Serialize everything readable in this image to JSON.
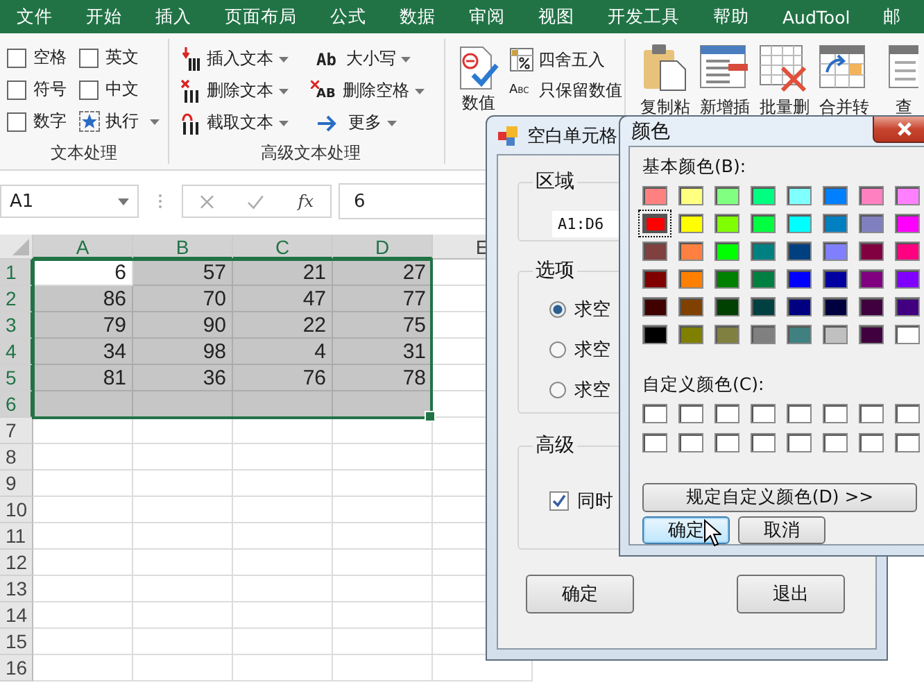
{
  "ribbon": {
    "tabs": [
      "文件",
      "开始",
      "插入",
      "页面布局",
      "公式",
      "数据",
      "审阅",
      "视图",
      "开发工具",
      "帮助",
      "AudTool",
      "邮"
    ],
    "text_group": {
      "title": "文本处理",
      "options": [
        {
          "label": "空格",
          "checked": false
        },
        {
          "label": "英文",
          "checked": false
        },
        {
          "label": "符号",
          "checked": false
        },
        {
          "label": "中文",
          "checked": false
        },
        {
          "label": "数字",
          "checked": false
        }
      ],
      "run_button": "执行"
    },
    "advanced_group": {
      "title": "高级文本处理",
      "buttons": [
        {
          "label": "插入文本",
          "kind": "insert"
        },
        {
          "label": "大小写",
          "kind": "case",
          "icon_text": "Ab"
        },
        {
          "label": "删除文本",
          "kind": "delete"
        },
        {
          "label": "删除空格",
          "kind": "trim",
          "icon_text": "AB"
        },
        {
          "label": "截取文本",
          "kind": "extract"
        },
        {
          "label": "更多",
          "kind": "more"
        }
      ]
    },
    "number_group": {
      "big_button": "数值",
      "buttons": [
        {
          "label": "四舍五入",
          "kind": "round"
        },
        {
          "label": "只保留数值",
          "kind": "numbers",
          "icon_text": "Abc"
        }
      ]
    },
    "tools": [
      {
        "label": "复制粘",
        "kind": "paste"
      },
      {
        "label": "新增插",
        "kind": "insert-row"
      },
      {
        "label": "批量删",
        "kind": "delete-table"
      },
      {
        "label": "合并转",
        "kind": "merge"
      },
      {
        "label": "查",
        "kind": "find"
      }
    ]
  },
  "formula_bar": {
    "name_box": "A1",
    "function_button": "fx",
    "value": "6"
  },
  "sheet": {
    "columns": [
      {
        "label": "A",
        "selected": true
      },
      {
        "label": "B",
        "selected": true
      },
      {
        "label": "C",
        "selected": true
      },
      {
        "label": "D",
        "selected": true
      },
      {
        "label": "E",
        "selected": false
      }
    ],
    "rows": [
      {
        "label": "1",
        "selected": true,
        "cells": [
          {
            "value": "6",
            "active": true
          },
          {
            "value": "57",
            "active": false
          },
          {
            "value": "21",
            "active": false
          },
          {
            "value": "27",
            "active": false
          }
        ]
      },
      {
        "label": "2",
        "selected": true,
        "cells": [
          {
            "value": "86",
            "active": false
          },
          {
            "value": "70",
            "active": false
          },
          {
            "value": "47",
            "active": false
          },
          {
            "value": "77",
            "active": false
          }
        ]
      },
      {
        "label": "3",
        "selected": true,
        "cells": [
          {
            "value": "79",
            "active": false
          },
          {
            "value": "90",
            "active": false
          },
          {
            "value": "22",
            "active": false
          },
          {
            "value": "75",
            "active": false
          }
        ]
      },
      {
        "label": "4",
        "selected": true,
        "cells": [
          {
            "value": "34",
            "active": false
          },
          {
            "value": "98",
            "active": false
          },
          {
            "value": "4",
            "active": false
          },
          {
            "value": "31",
            "active": false
          }
        ]
      },
      {
        "label": "5",
        "selected": true,
        "cells": [
          {
            "value": "81",
            "active": false
          },
          {
            "value": "36",
            "active": false
          },
          {
            "value": "76",
            "active": false
          },
          {
            "value": "78",
            "active": false
          }
        ]
      },
      {
        "label": "6",
        "selected": true
      },
      {
        "label": "7",
        "selected": false
      },
      {
        "label": "8",
        "selected": false
      },
      {
        "label": "9",
        "selected": false
      },
      {
        "label": "10",
        "selected": false
      },
      {
        "label": "11",
        "selected": false
      },
      {
        "label": "12",
        "selected": false
      },
      {
        "label": "13",
        "selected": false
      },
      {
        "label": "14",
        "selected": false
      },
      {
        "label": "15",
        "selected": false
      },
      {
        "label": "16",
        "selected": false
      }
    ]
  },
  "blank_dialog": {
    "title": "空白单元格",
    "range_label": "区域",
    "range": "A1:D6",
    "options_label": "选项",
    "options": [
      {
        "label": "求空",
        "selected": true
      },
      {
        "label": "求空",
        "selected": false
      },
      {
        "label": "求空",
        "selected": false
      }
    ],
    "advanced_label": "高级",
    "advanced_option": {
      "label": "同时",
      "checked": true
    },
    "buttons": [
      "确定",
      "退出"
    ]
  },
  "color_dialog": {
    "title": "颜色",
    "basic_label": "基本颜色(B):",
    "basic_colors": [
      {
        "color": "#ff8080",
        "selected": false
      },
      {
        "color": "#ffff80",
        "selected": false
      },
      {
        "color": "#80ff80",
        "selected": false
      },
      {
        "color": "#00ff80",
        "selected": false
      },
      {
        "color": "#80ffff",
        "selected": false
      },
      {
        "color": "#0080ff",
        "selected": false
      },
      {
        "color": "#ff80c0",
        "selected": false
      },
      {
        "color": "#ff80ff",
        "selected": false
      },
      {
        "color": "#ff0000",
        "selected": true
      },
      {
        "color": "#ffff00",
        "selected": false
      },
      {
        "color": "#80ff00",
        "selected": false
      },
      {
        "color": "#00ff40",
        "selected": false
      },
      {
        "color": "#00ffff",
        "selected": false
      },
      {
        "color": "#0080c0",
        "selected": false
      },
      {
        "color": "#8080c0",
        "selected": false
      },
      {
        "color": "#ff00ff",
        "selected": false
      },
      {
        "color": "#804040",
        "selected": false
      },
      {
        "color": "#ff8040",
        "selected": false
      },
      {
        "color": "#00ff00",
        "selected": false
      },
      {
        "color": "#008080",
        "selected": false
      },
      {
        "color": "#004080",
        "selected": false
      },
      {
        "color": "#8080ff",
        "selected": false
      },
      {
        "color": "#800040",
        "selected": false
      },
      {
        "color": "#ff0080",
        "selected": false
      },
      {
        "color": "#800000",
        "selected": false
      },
      {
        "color": "#ff8000",
        "selected": false
      },
      {
        "color": "#008000",
        "selected": false
      },
      {
        "color": "#008040",
        "selected": false
      },
      {
        "color": "#0000ff",
        "selected": false
      },
      {
        "color": "#0000a0",
        "selected": false
      },
      {
        "color": "#800080",
        "selected": false
      },
      {
        "color": "#8000ff",
        "selected": false
      },
      {
        "color": "#400000",
        "selected": false
      },
      {
        "color": "#804000",
        "selected": false
      },
      {
        "color": "#004000",
        "selected": false
      },
      {
        "color": "#004040",
        "selected": false
      },
      {
        "color": "#000080",
        "selected": false
      },
      {
        "color": "#000040",
        "selected": false
      },
      {
        "color": "#400040",
        "selected": false
      },
      {
        "color": "#400080",
        "selected": false
      },
      {
        "color": "#000000",
        "selected": false
      },
      {
        "color": "#808000",
        "selected": false
      },
      {
        "color": "#808040",
        "selected": false
      },
      {
        "color": "#808080",
        "selected": false
      },
      {
        "color": "#408080",
        "selected": false
      },
      {
        "color": "#c0c0c0",
        "selected": false
      },
      {
        "color": "#400040",
        "selected": false
      },
      {
        "color": "#ffffff",
        "selected": false
      }
    ],
    "custom_label": "自定义颜色(C):",
    "custom_colors": [
      {
        "color": "#ffffff"
      },
      {
        "color": "#ffffff"
      },
      {
        "color": "#ffffff"
      },
      {
        "color": "#ffffff"
      },
      {
        "color": "#ffffff"
      },
      {
        "color": "#ffffff"
      },
      {
        "color": "#ffffff"
      },
      {
        "color": "#ffffff"
      },
      {
        "color": "#ffffff"
      },
      {
        "color": "#ffffff"
      },
      {
        "color": "#ffffff"
      },
      {
        "color": "#ffffff"
      },
      {
        "color": "#ffffff"
      },
      {
        "color": "#ffffff"
      },
      {
        "color": "#ffffff"
      },
      {
        "color": "#ffffff"
      }
    ],
    "define_button": "规定自定义颜色(D) >>",
    "buttons": [
      {
        "label": "确定",
        "default": true
      },
      {
        "label": "取消",
        "default": false
      }
    ]
  }
}
